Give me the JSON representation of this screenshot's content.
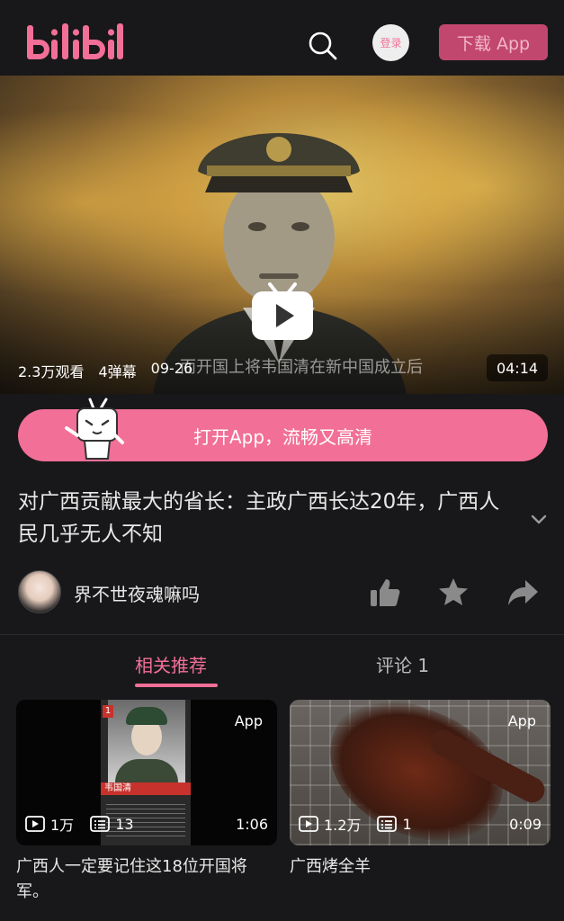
{
  "header": {
    "logo_text": "bilibili",
    "login_label": "登录",
    "download_label": "下载 App"
  },
  "video": {
    "views": "2.3万观看",
    "danmaku": "4弹幕",
    "date": "09-26",
    "duration": "04:14",
    "subtitle": "而开国上将韦国清在新中国成立后"
  },
  "open_app_label": "打开App，流畅又高清",
  "title": "对广西贡献最大的省长：主政广西长达20年，广西人民几乎无人不知",
  "author": {
    "name": "界不世夜魂嘛吗"
  },
  "tabs": {
    "related": "相关推荐",
    "comments": "评论 1"
  },
  "cards": [
    {
      "badge": "App",
      "views": "1万",
      "danmaku": "13",
      "duration": "1:06",
      "title": "广西人一定要记住这18位开国将军。",
      "poster_name": "韦国清",
      "poster_num": "1"
    },
    {
      "badge": "App",
      "views": "1.2万",
      "danmaku": "1",
      "duration": "0:09",
      "title": "广西烤全羊"
    }
  ],
  "colors": {
    "brand_pink": "#f26f97",
    "background": "#18181a"
  }
}
